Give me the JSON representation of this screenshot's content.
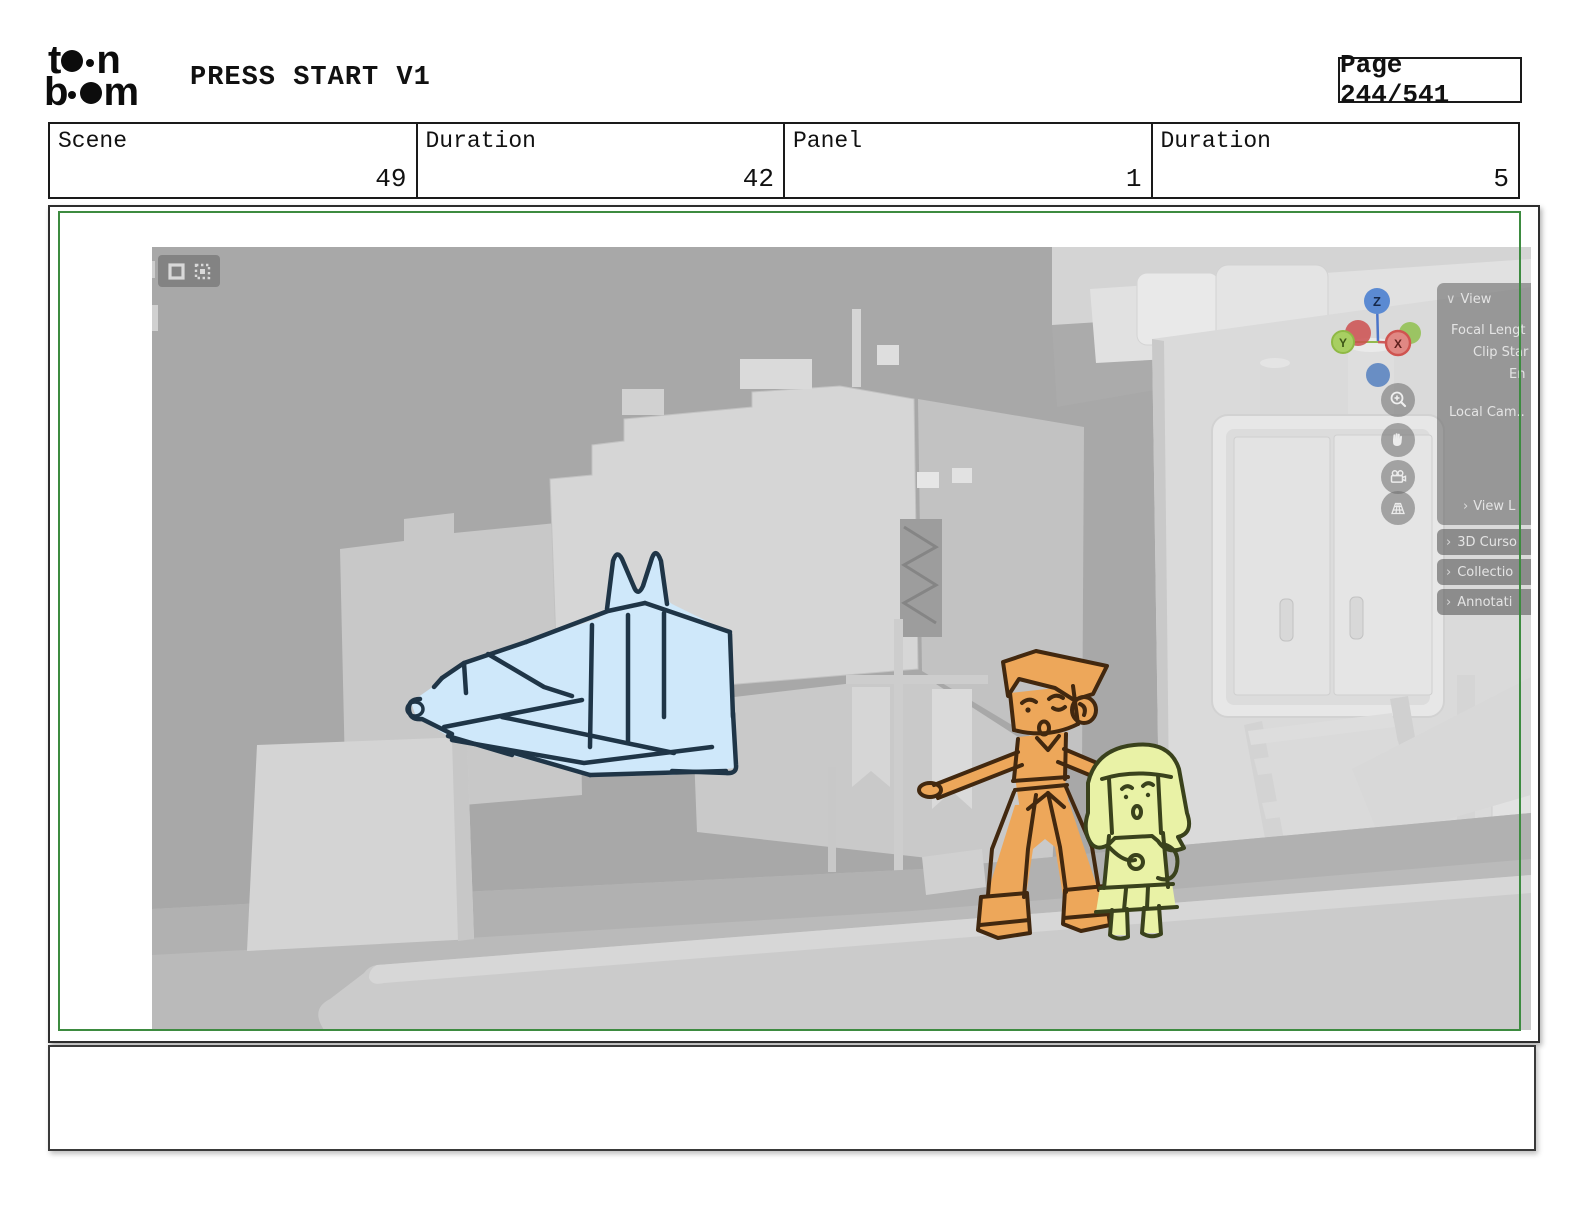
{
  "header": {
    "logo": {
      "l1a": "t",
      "l1b": "n",
      "l2a": "b",
      "l2b": "m",
      "brand": "toon boom"
    },
    "title": "PRESS START V1",
    "page_label": "Page 244/541"
  },
  "info_row": {
    "cells": [
      {
        "label": "Scene",
        "value": "49"
      },
      {
        "label": "Duration",
        "value": "42"
      },
      {
        "label": "Panel",
        "value": "1"
      },
      {
        "label": "Duration",
        "value": "5"
      }
    ]
  },
  "viewport": {
    "sidebar": {
      "chevron_down": "∨",
      "chevron_right": "›",
      "view_header": "View",
      "fields": [
        "Focal Lengt",
        "Clip Star",
        "En",
        "Local Cam..",
        "View L"
      ],
      "collapsed": [
        "3D Curso",
        "Collectio",
        "Annotati"
      ]
    },
    "gizmo": {
      "z": "Z",
      "y": "Y",
      "x": "X"
    },
    "tools": [
      "zoom-in",
      "pan-hand",
      "camera-view",
      "grid-perspective"
    ]
  },
  "caption": {
    "text": ""
  },
  "colors": {
    "panel_border_green": "#3d8b40",
    "viewport_bg": "#a8a8a8",
    "sketch_blue_fill": "#cfe8fa",
    "sketch_blue_line": "#1f3547",
    "char_orange_fill": "#eda75a",
    "char_orange_line": "#42280f",
    "char_yellow_fill": "#e9f2a6",
    "char_yellow_line": "#3a421c",
    "axis_z_blue": "#5b8ad2",
    "axis_x_red": "#cf5450",
    "axis_y_green": "#a8cf62"
  }
}
